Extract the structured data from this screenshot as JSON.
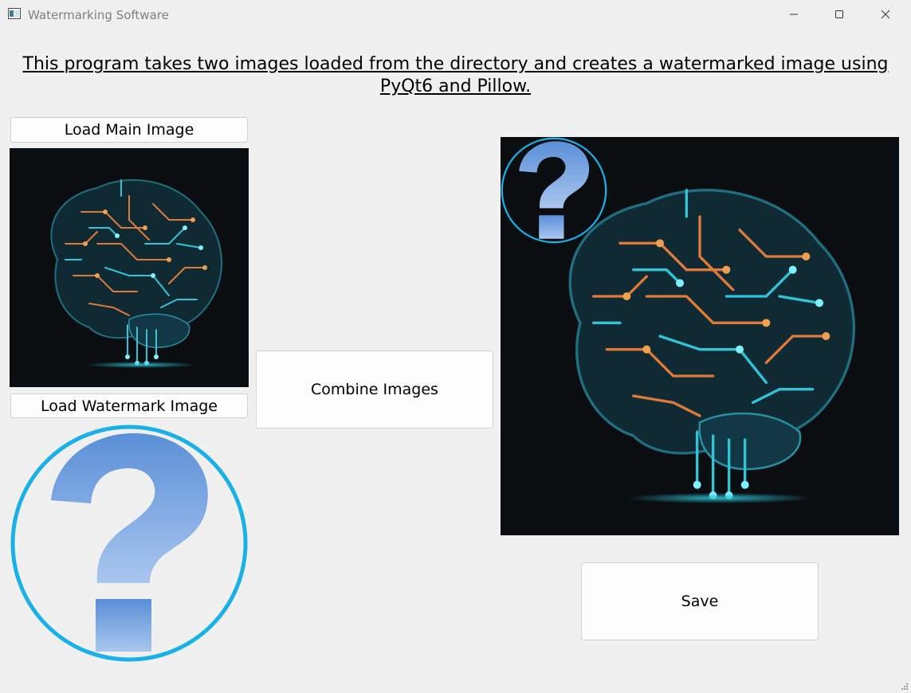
{
  "window": {
    "title": "Watermarking Software",
    "icon": "app-window-icon",
    "controls": {
      "minimize": "minimize-icon",
      "maximize": "maximize-icon",
      "close": "close-icon"
    }
  },
  "description": "This program takes two images loaded from the directory and creates a watermarked image using PyQt6 and Pillow.",
  "buttons": {
    "load_main": "Load Main Image",
    "load_watermark": "Load Watermark Image",
    "combine": "Combine Images",
    "save": "Save"
  },
  "images": {
    "main": "circuit-brain-image",
    "watermark": "question-mark-image",
    "result": "watermarked-brain-image"
  },
  "colors": {
    "background": "#f0f0f0",
    "image_background": "#0a0e11",
    "question_blue": "#5a8fd8",
    "circle_cyan": "#1ab0e8",
    "circuit_orange": "#e07a3a",
    "circuit_cyan": "#2fc4d8"
  }
}
